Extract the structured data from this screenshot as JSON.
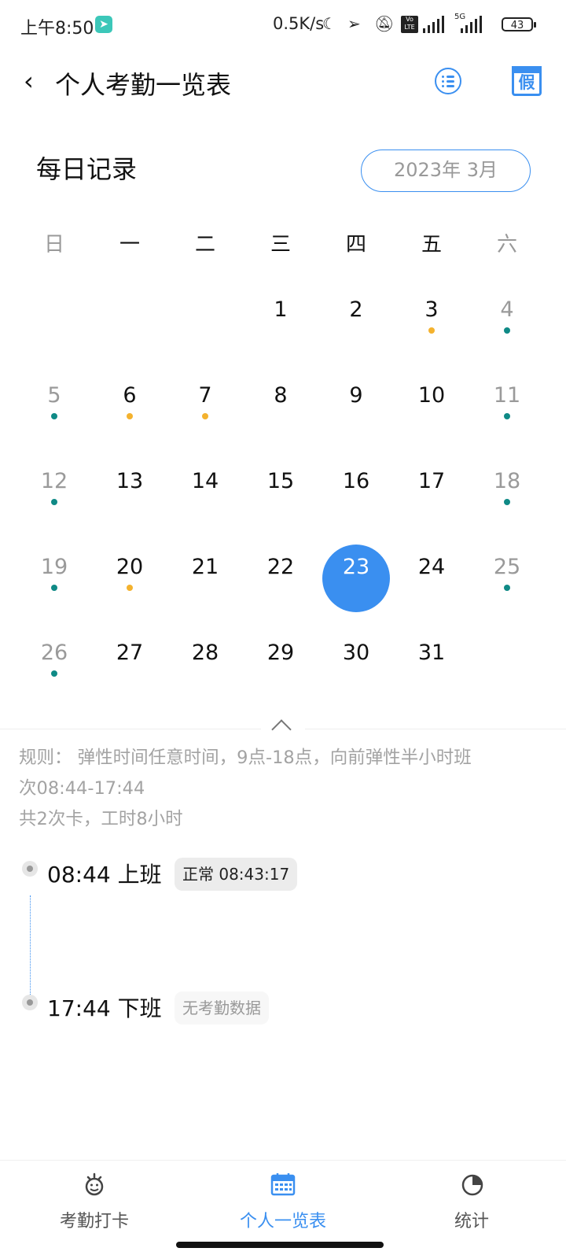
{
  "status_bar": {
    "time": "上午8:50",
    "network_speed": "0.5K/s",
    "battery": "43",
    "volte": "Vo LTE",
    "network_type": "5G",
    "icons": [
      "navigation-app-icon",
      "moon-icon",
      "location-arrow-icon",
      "mute-icon",
      "volte-icon",
      "signal-icon",
      "5g-signal-icon",
      "battery-icon"
    ]
  },
  "header": {
    "back_icon": "‹",
    "title": "个人考勤一览表",
    "list_icon": "list-icon",
    "leave_calendar_label": "假"
  },
  "daily": {
    "title": "每日记录",
    "month": "2023年 3月"
  },
  "calendar": {
    "weekdays": [
      "日",
      "一",
      "二",
      "三",
      "四",
      "五",
      "六"
    ],
    "selected_day": "23",
    "colors": {
      "teal": "#0f8a86",
      "orange": "#f4b22e",
      "selected": "#3a8ff0"
    },
    "weeks": [
      [
        {
          "d": ""
        },
        {
          "d": ""
        },
        {
          "d": ""
        },
        {
          "d": "1"
        },
        {
          "d": "2"
        },
        {
          "d": "3",
          "dot": "orange"
        },
        {
          "d": "4",
          "dot": "teal"
        }
      ],
      [
        {
          "d": "5",
          "dot": "teal"
        },
        {
          "d": "6",
          "dot": "orange"
        },
        {
          "d": "7",
          "dot": "orange"
        },
        {
          "d": "8"
        },
        {
          "d": "9"
        },
        {
          "d": "10"
        },
        {
          "d": "11",
          "dot": "teal"
        }
      ],
      [
        {
          "d": "12",
          "dot": "teal"
        },
        {
          "d": "13"
        },
        {
          "d": "14"
        },
        {
          "d": "15"
        },
        {
          "d": "16"
        },
        {
          "d": "17"
        },
        {
          "d": "18",
          "dot": "teal"
        }
      ],
      [
        {
          "d": "19",
          "dot": "teal"
        },
        {
          "d": "20",
          "dot": "orange"
        },
        {
          "d": "21"
        },
        {
          "d": "22"
        },
        {
          "d": "23"
        },
        {
          "d": "24"
        },
        {
          "d": "25",
          "dot": "teal"
        }
      ],
      [
        {
          "d": "26",
          "dot": "teal"
        },
        {
          "d": "27"
        },
        {
          "d": "28"
        },
        {
          "d": "29"
        },
        {
          "d": "30"
        },
        {
          "d": "31"
        },
        {
          "d": ""
        }
      ]
    ]
  },
  "rules": {
    "line1": "规则： 弹性时间任意时间，9点-18点，向前弹性半小时班",
    "line2": "次08:44-17:44",
    "line3": "共2次卡，工时8小时"
  },
  "records": [
    {
      "time_label": "08:44 上班",
      "status": "正常 08:43:17"
    },
    {
      "time_label": "17:44 下班",
      "status": "无考勤数据"
    }
  ],
  "nav": {
    "items": [
      {
        "label": "考勤打卡",
        "icon": "clock-in-icon"
      },
      {
        "label": "个人一览表",
        "icon": "calendar-icon",
        "active": true
      },
      {
        "label": "统计",
        "icon": "pie-chart-icon"
      }
    ]
  }
}
